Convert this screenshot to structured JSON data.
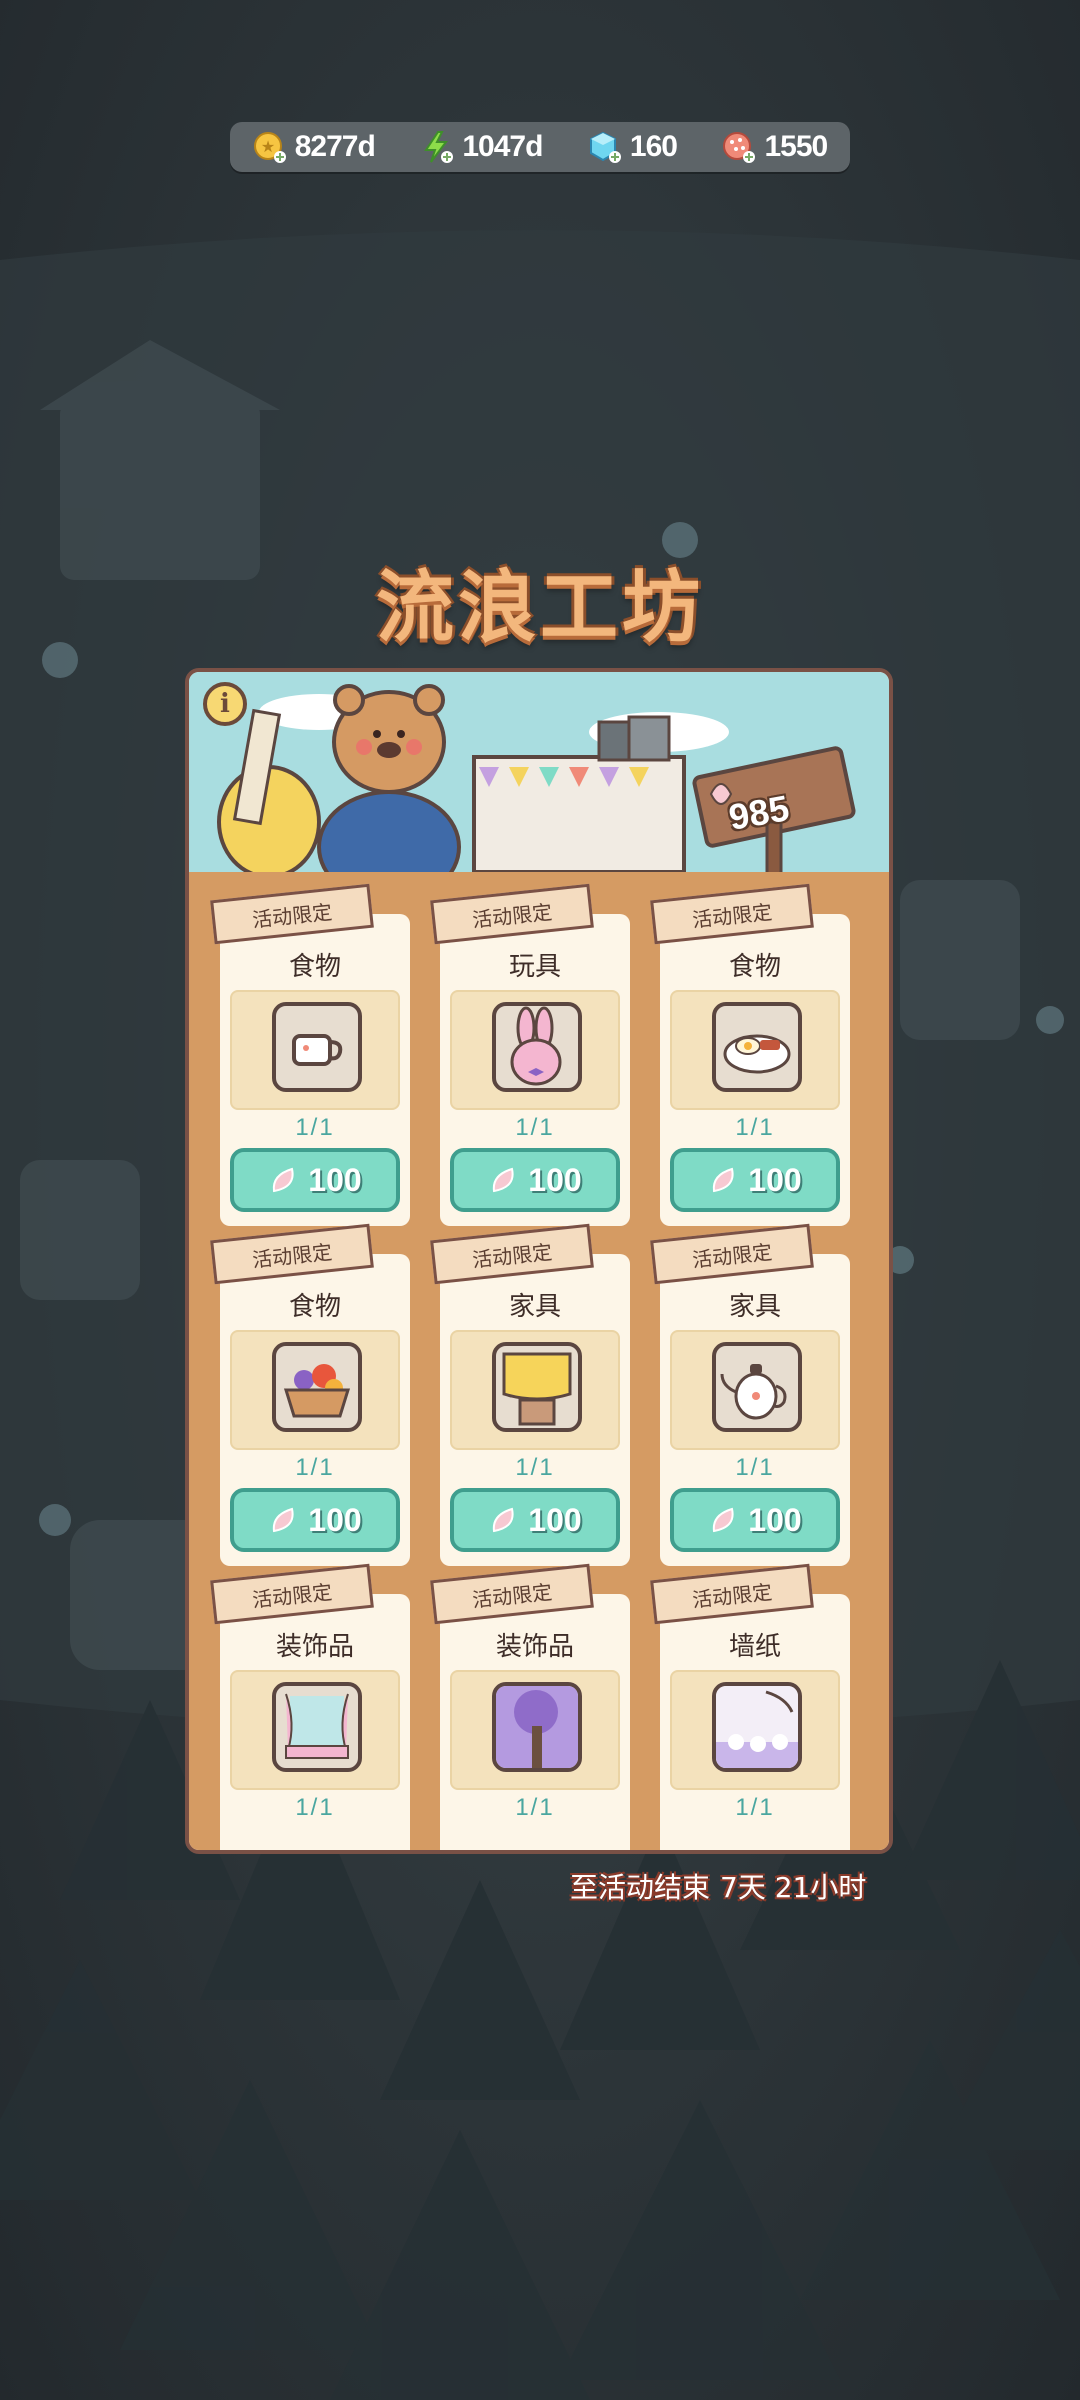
{
  "resources": [
    {
      "icon": "coin-icon",
      "value": "8277d"
    },
    {
      "icon": "energy-icon",
      "value": "1047d"
    },
    {
      "icon": "gem-icon",
      "value": "160"
    },
    {
      "icon": "candy-icon",
      "value": "1550"
    }
  ],
  "title": "流浪工坊",
  "banner": {
    "info_label": "i",
    "petal_count": "985"
  },
  "colors": {
    "accent_teal": "#7fdbc6",
    "title_orange": "#f3b77d",
    "shelf": "#d59b63"
  },
  "items": [
    {
      "tag": "活动限定",
      "category": "食物",
      "icon": "teacup-icon",
      "stock": "1/1",
      "price": "100"
    },
    {
      "tag": "活动限定",
      "category": "玩具",
      "icon": "bunny-plush-icon",
      "stock": "1/1",
      "price": "100"
    },
    {
      "tag": "活动限定",
      "category": "食物",
      "icon": "breakfast-plate-icon",
      "stock": "1/1",
      "price": "100"
    },
    {
      "tag": "活动限定",
      "category": "食物",
      "icon": "fruit-basket-icon",
      "stock": "1/1",
      "price": "100"
    },
    {
      "tag": "活动限定",
      "category": "家具",
      "icon": "lamp-table-icon",
      "stock": "1/1",
      "price": "100"
    },
    {
      "tag": "活动限定",
      "category": "家具",
      "icon": "teapot-icon",
      "stock": "1/1",
      "price": "100"
    },
    {
      "tag": "活动限定",
      "category": "装饰品",
      "icon": "curtain-window-icon",
      "stock": "1/1",
      "price": ""
    },
    {
      "tag": "活动限定",
      "category": "装饰品",
      "icon": "tree-painting-icon",
      "stock": "1/1",
      "price": ""
    },
    {
      "tag": "活动限定",
      "category": "墙纸",
      "icon": "wallpaper-icon",
      "stock": "1/1",
      "price": ""
    }
  ],
  "countdown": {
    "label": "至活动结束",
    "time": "7天 21小时"
  }
}
